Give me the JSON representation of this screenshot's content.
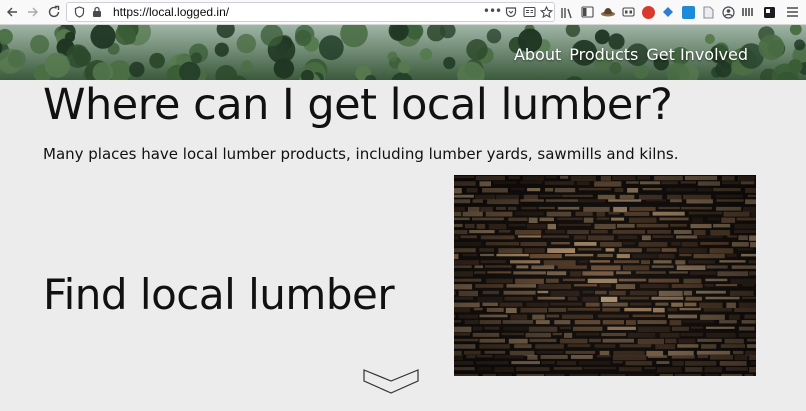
{
  "browser": {
    "url": "https://local.logged.in/"
  },
  "site": {
    "nav": [
      "About",
      "Products",
      "Get Involved"
    ],
    "headline": "Where can I get local lumber?",
    "intro": "Many places have local lumber products, including lumber yards, sawmills and kilns.",
    "section_title": "Find local lumber"
  },
  "colors": {
    "page_bg": "#ececec",
    "forest": "#2f4a2f",
    "text": "#111111",
    "nav_text": "#ffffff"
  }
}
